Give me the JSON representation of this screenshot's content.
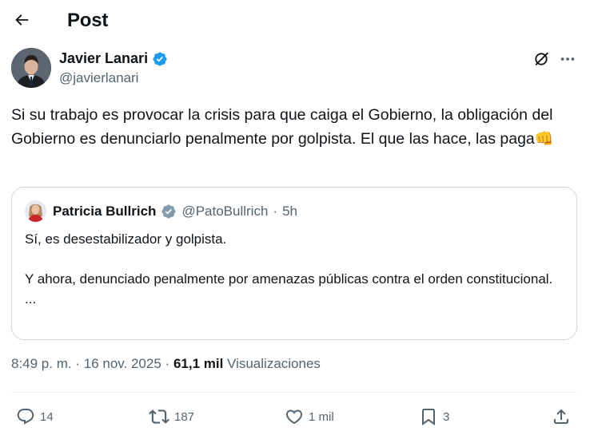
{
  "header": {
    "title": "Post"
  },
  "author": {
    "name": "Javier Lanari",
    "handle": "@javierlanari"
  },
  "post": {
    "text": "Si su trabajo es provocar la crisis para que caiga el Gobierno, la obligación del Gobierno es denunciarlo penalmente por golpista. El que las hace, las paga",
    "emoji": "👊"
  },
  "quote": {
    "name": "Patricia Bullrich",
    "handle": "@PatoBullrich",
    "separator": "·",
    "time": "5h",
    "line1": "Sí, es desestabilizador y golpista.",
    "line2": "Y ahora, denunciado penalmente por amenazas públicas contra el orden constitucional.",
    "ellipsis": "..."
  },
  "meta": {
    "time": "8:49 p. m.",
    "separator": "·",
    "date": "16 nov. 2025",
    "views_count": "61,1 mil",
    "views_label": "Visualizaciones"
  },
  "actions": {
    "replies": "14",
    "reposts": "187",
    "likes": "1 mil",
    "bookmarks": "3"
  },
  "colors": {
    "text": "#0f1419",
    "secondary": "#536471",
    "verified": "#1d9bf0",
    "quote_verified": "#829aab",
    "border": "#cfd9de"
  },
  "icons": [
    "back-arrow-icon",
    "verified-badge-icon",
    "grok-icon",
    "more-icon",
    "reply-icon",
    "repost-icon",
    "like-icon",
    "bookmark-icon",
    "share-icon"
  ]
}
